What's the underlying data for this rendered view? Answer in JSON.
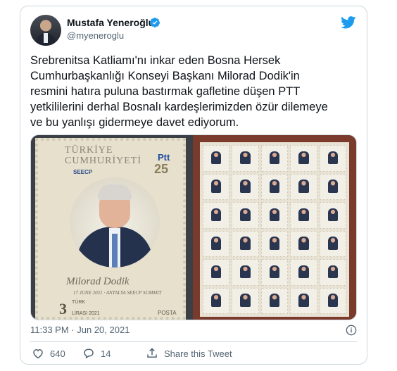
{
  "author": {
    "name": "Mustafa Yeneroğlu",
    "handle": "@myeneroglu",
    "verified": true
  },
  "tweet": {
    "text": "Srebrenitsa Katliamı'nı inkar eden Bosna Hersek\nCumhurbaşkanlığı Konseyi Başkanı Milorad Dodik'in\nresmini hatıra puluna bastırmak gafletine düşen PTT\nyetkililerini derhal Bosnalı kardeşlerimizden özür dilemeye\nve bu yanlışı gidermeye davet ediyorum.",
    "timestamp": "11:33 PM · Jun 20, 2021"
  },
  "media": {
    "stamp": {
      "country_line1": "TÜRKİYE",
      "country_line2": "CUMHURİYETİ",
      "ptt_logo": "Ptt",
      "seecp_logo": "SEECP",
      "anniversary": "25",
      "signature_name": "Milorad Dodik",
      "summit_line": "17 JUNE 2021 · ANTALYA SEECP SUMMIT",
      "face_value": "3",
      "currency_line1": "TÜRK",
      "currency_line2": "LİRASI 2021",
      "posta": "POSTA"
    }
  },
  "actions": {
    "likes": "640",
    "replies": "14",
    "share_label": "Share this Tweet"
  },
  "colors": {
    "verified_blue": "#1d9bf0",
    "twitter_blue": "#1d9bf0",
    "secondary_text": "#536471"
  },
  "icons": {
    "verified": "verified-badge-icon",
    "twitter": "twitter-bird-icon",
    "info": "info-icon",
    "like": "heart-icon",
    "reply": "reply-icon",
    "share": "share-icon"
  }
}
